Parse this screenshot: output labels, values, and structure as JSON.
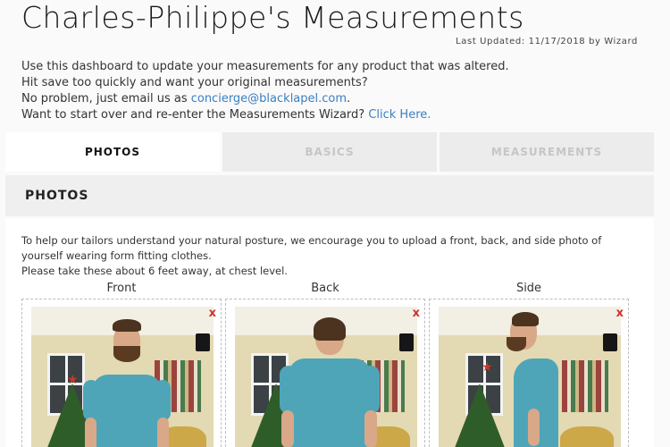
{
  "page": {
    "title": "Charles-Philippe's Measurements",
    "last_updated": "Last Updated: 11/17/2018 by Wizard"
  },
  "intro": {
    "line1": "Use this dashboard to update your measurements for any product that was altered.",
    "line2": "Hit save too quickly and want your original measurements?",
    "line3_prefix": "No problem, just email us as ",
    "email": "concierge@blacklapel.com",
    "line3_suffix": ".",
    "line4_prefix": "Want to start over and re-enter the Measurements Wizard? ",
    "click_here": "Click Here."
  },
  "tabs": [
    {
      "label": "PHOTOS",
      "active": true
    },
    {
      "label": "BASICS",
      "active": false
    },
    {
      "label": "MEASUREMENTS",
      "active": false
    }
  ],
  "section": {
    "title": "PHOTOS",
    "instructions_1": "To help our tailors understand your natural posture, we encourage you to upload a front, back, and side photo of yourself wearing form fitting clothes.",
    "instructions_2": "Please take these about 6 feet away, at chest level."
  },
  "photos": [
    {
      "label": "Front",
      "remove": "x",
      "icon": "photo-front"
    },
    {
      "label": "Back",
      "remove": "x",
      "icon": "photo-back"
    },
    {
      "label": "Side",
      "remove": "x",
      "icon": "photo-side"
    }
  ],
  "colors": {
    "accent_link": "#3a7fc1",
    "remove_red": "#d0312d",
    "shirt": "#4fa5b8"
  }
}
